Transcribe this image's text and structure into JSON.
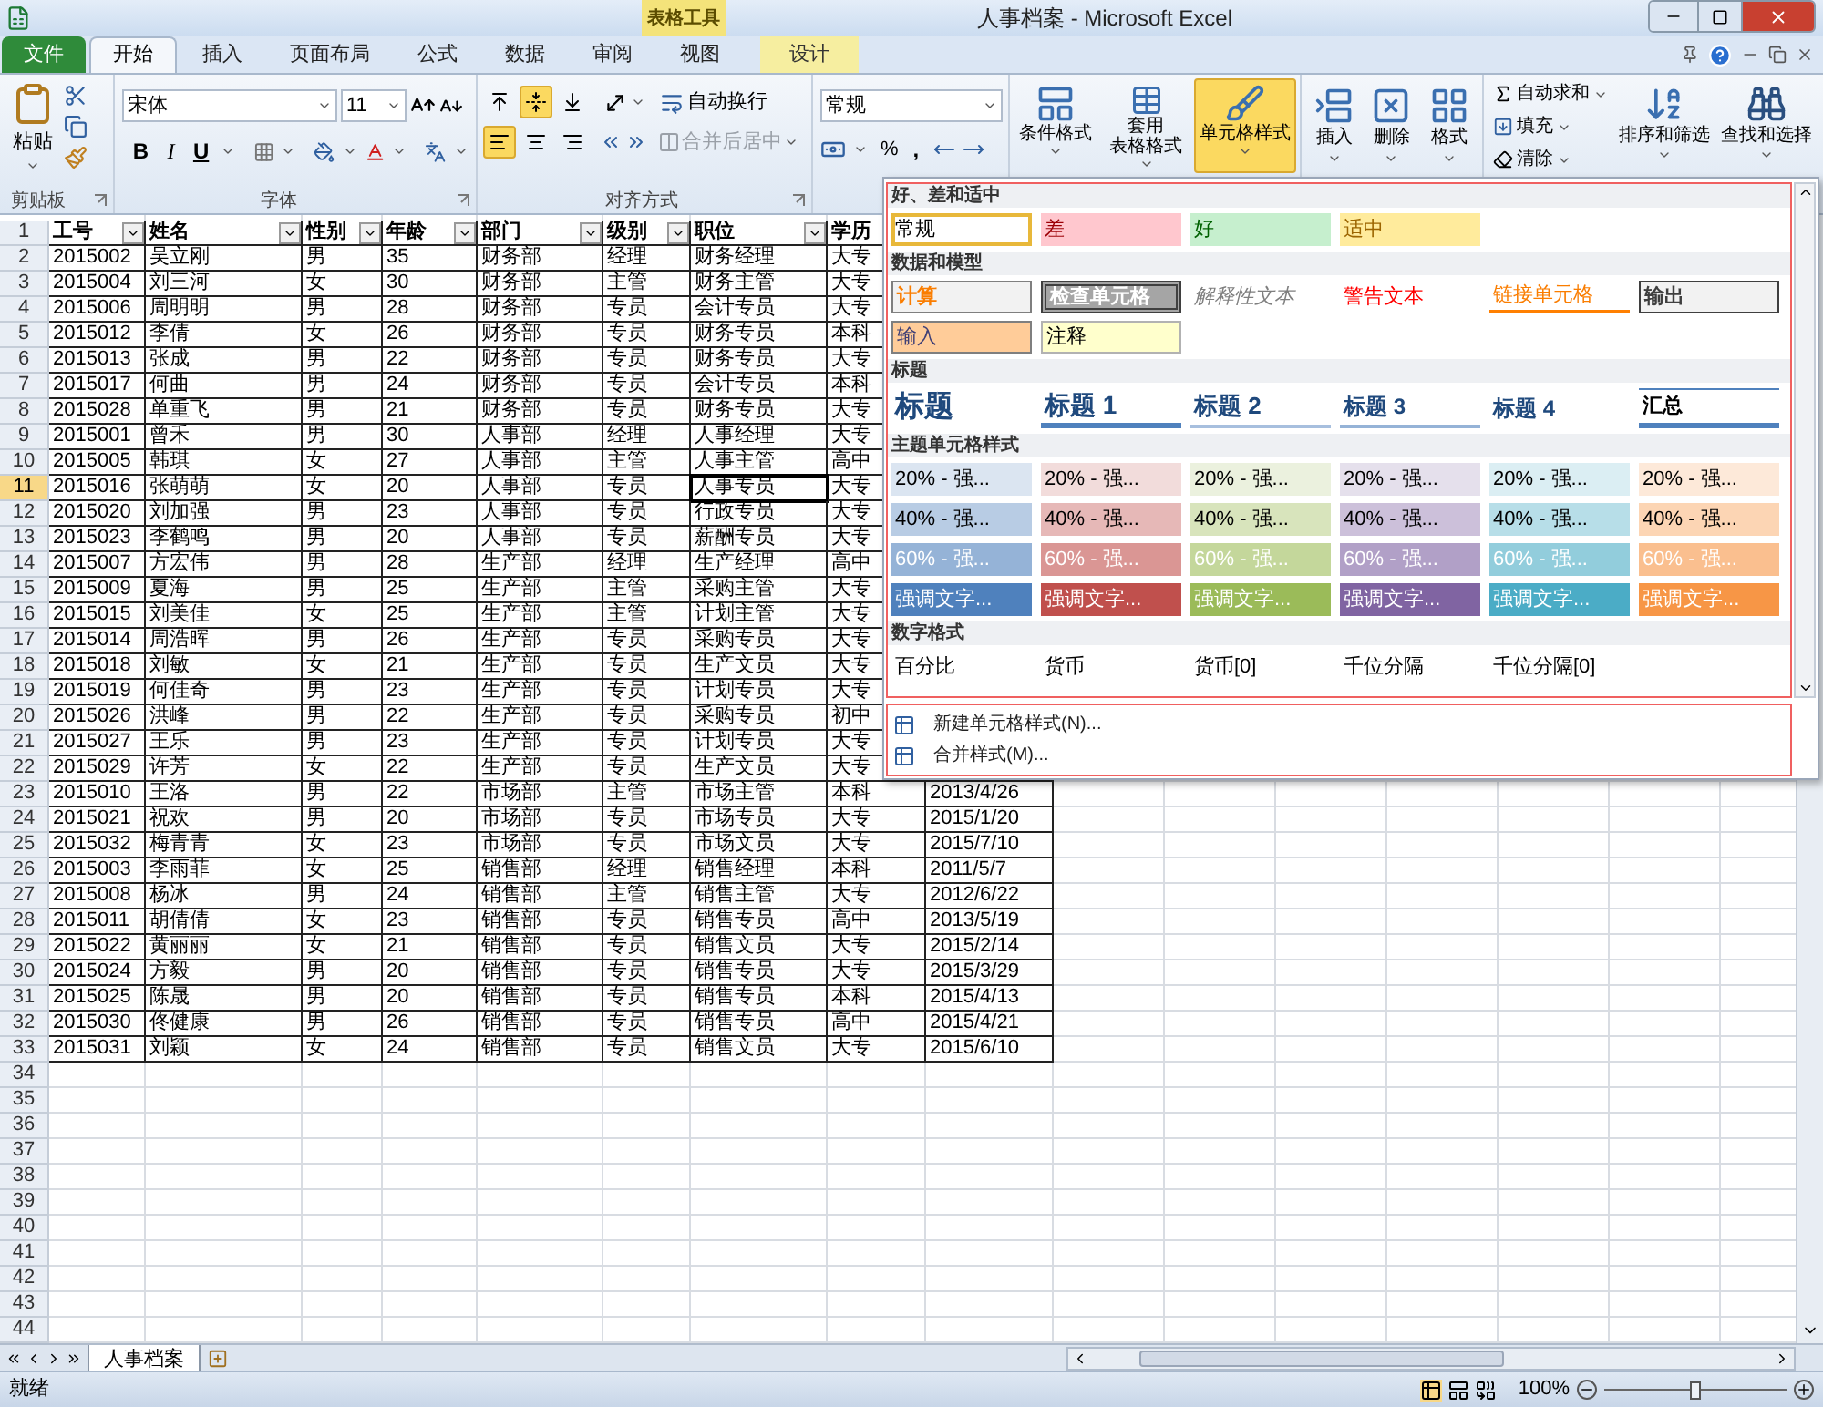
{
  "title_bar": {
    "context_group": "表格工具",
    "title": "人事档案 - Microsoft Excel"
  },
  "tabs": [
    {
      "label": "文件",
      "kind": "file",
      "selected": false
    },
    {
      "label": "开始",
      "kind": "normal",
      "selected": true
    },
    {
      "label": "插入",
      "kind": "normal",
      "selected": false
    },
    {
      "label": "页面布局",
      "kind": "normal",
      "selected": false
    },
    {
      "label": "公式",
      "kind": "normal",
      "selected": false
    },
    {
      "label": "数据",
      "kind": "normal",
      "selected": false
    },
    {
      "label": "审阅",
      "kind": "normal",
      "selected": false
    },
    {
      "label": "视图",
      "kind": "normal",
      "selected": false
    },
    {
      "label": "设计",
      "kind": "context",
      "selected": false
    }
  ],
  "ribbon": {
    "clipboard": {
      "paste": "粘贴",
      "label": "剪贴板"
    },
    "font": {
      "name": "宋体",
      "size": "11",
      "bold": "B",
      "italic": "I",
      "underline": "U",
      "label": "字体"
    },
    "alignment": {
      "vertical": [
        {
          "kind": "top",
          "selected": false
        },
        {
          "kind": "middle",
          "selected": true
        },
        {
          "kind": "bottom",
          "selected": false
        }
      ],
      "horizontal": [
        {
          "kind": "left",
          "selected": true
        },
        {
          "kind": "center",
          "selected": false
        },
        {
          "kind": "right",
          "selected": false
        }
      ],
      "wrap": "自动换行",
      "merge": {
        "label": "合并后居中",
        "disabled": true
      },
      "label": "对齐方式"
    },
    "number": {
      "format": "常规",
      "percent": "%",
      "comma": ","
    },
    "styles": [
      {
        "lines": [
          "条件格式"
        ],
        "kind": "conditional",
        "selected": false
      },
      {
        "lines": [
          "套用",
          "表格格式"
        ],
        "kind": "table",
        "selected": false
      },
      {
        "lines": [
          "单元格样式"
        ],
        "kind": "cell",
        "selected": true
      }
    ],
    "cells": [
      {
        "label": "插入",
        "kind": "insert"
      },
      {
        "label": "删除",
        "kind": "delete"
      },
      {
        "label": "格式",
        "kind": "format"
      }
    ],
    "editing": {
      "autosum": "自动求和",
      "fill": "填充",
      "clear": "清除",
      "sort": "排序和筛选",
      "find": "查找和选择"
    }
  },
  "sheet": {
    "columns": [
      {
        "label": "工号",
        "filter": true
      },
      {
        "label": "姓名",
        "filter": true
      },
      {
        "label": "性别",
        "filter": true
      },
      {
        "label": "年龄",
        "filter": true
      },
      {
        "label": "部门",
        "filter": true
      },
      {
        "label": "级别",
        "filter": true
      },
      {
        "label": "职位",
        "filter": true
      },
      {
        "label": "学历"
      }
    ],
    "header_row": "1",
    "rows": [
      {
        "number": "2",
        "selected": false,
        "cells": [
          "2015002",
          "吴立刚",
          "男",
          "35",
          "财务部",
          "经理",
          "财务经理",
          "大专"
        ]
      },
      {
        "number": "3",
        "selected": false,
        "cells": [
          "2015004",
          "刘三河",
          "女",
          "30",
          "财务部",
          "主管",
          "财务主管",
          "大专"
        ]
      },
      {
        "number": "4",
        "selected": false,
        "cells": [
          "2015006",
          "周明明",
          "男",
          "28",
          "财务部",
          "专员",
          "会计专员",
          "大专"
        ]
      },
      {
        "number": "5",
        "selected": false,
        "cells": [
          "2015012",
          "李倩",
          "女",
          "26",
          "财务部",
          "专员",
          "财务专员",
          "本科"
        ]
      },
      {
        "number": "6",
        "selected": false,
        "cells": [
          "2015013",
          "张成",
          "男",
          "22",
          "财务部",
          "专员",
          "财务专员",
          "大专"
        ]
      },
      {
        "number": "7",
        "selected": false,
        "cells": [
          "2015017",
          "何曲",
          "男",
          "24",
          "财务部",
          "专员",
          "会计专员",
          "本科"
        ]
      },
      {
        "number": "8",
        "selected": false,
        "cells": [
          "2015028",
          "单重飞",
          "男",
          "21",
          "财务部",
          "专员",
          "财务专员",
          "大专"
        ]
      },
      {
        "number": "9",
        "selected": false,
        "cells": [
          "2015001",
          "曾禾",
          "男",
          "30",
          "人事部",
          "经理",
          "人事经理",
          "大专"
        ]
      },
      {
        "number": "10",
        "selected": false,
        "cells": [
          "2015005",
          "韩琪",
          "女",
          "27",
          "人事部",
          "主管",
          "人事主管",
          "高中"
        ]
      },
      {
        "number": "11",
        "selected": true,
        "cells": [
          {
            "text": "2015016",
            "selected": false
          },
          {
            "text": "张萌萌",
            "selected": false
          },
          {
            "text": "女",
            "selected": false
          },
          {
            "text": "20",
            "selected": false
          },
          {
            "text": "人事部",
            "selected": false
          },
          {
            "text": "专员",
            "selected": false
          },
          {
            "text": "人事专员",
            "selected": true
          },
          {
            "text": "大专",
            "selected": false
          }
        ]
      },
      {
        "number": "12",
        "selected": false,
        "cells": [
          "2015020",
          "刘加强",
          "男",
          "23",
          "人事部",
          "专员",
          "行政专员",
          "大专"
        ]
      },
      {
        "number": "13",
        "selected": false,
        "cells": [
          "2015023",
          "李鹤鸣",
          "男",
          "20",
          "人事部",
          "专员",
          "薪酬专员",
          "大专"
        ]
      },
      {
        "number": "14",
        "selected": false,
        "cells": [
          "2015007",
          "方宏伟",
          "男",
          "28",
          "生产部",
          "经理",
          "生产经理",
          "高中"
        ]
      },
      {
        "number": "15",
        "selected": false,
        "cells": [
          "2015009",
          "夏海",
          "男",
          "25",
          "生产部",
          "主管",
          "采购主管",
          "大专"
        ]
      },
      {
        "number": "16",
        "selected": false,
        "cells": [
          "2015015",
          "刘美佳",
          "女",
          "25",
          "生产部",
          "主管",
          "计划主管",
          "大专"
        ]
      },
      {
        "number": "17",
        "selected": false,
        "cells": [
          "2015014",
          "周浩晖",
          "男",
          "26",
          "生产部",
          "专员",
          "采购专员",
          "大专"
        ]
      },
      {
        "number": "18",
        "selected": false,
        "cells": [
          "2015018",
          "刘敏",
          "女",
          "21",
          "生产部",
          "专员",
          "生产文员",
          "大专"
        ]
      },
      {
        "number": "19",
        "selected": false,
        "cells": [
          "2015019",
          "何佳奇",
          "男",
          "23",
          "生产部",
          "专员",
          "计划专员",
          "大专"
        ]
      },
      {
        "number": "20",
        "selected": false,
        "cells": [
          "2015026",
          "洪峰",
          "男",
          "22",
          "生产部",
          "专员",
          "采购专员",
          "初中"
        ]
      },
      {
        "number": "21",
        "selected": false,
        "cells": [
          "2015027",
          "王乐",
          "男",
          "23",
          "生产部",
          "专员",
          "计划专员",
          "大专"
        ]
      },
      {
        "number": "22",
        "selected": false,
        "cells": [
          "2015029",
          "许芳",
          "女",
          "22",
          "生产部",
          "专员",
          "生产文员",
          "大专"
        ]
      },
      {
        "number": "23",
        "selected": false,
        "cells": [
          "2015010",
          "王洛",
          "男",
          "22",
          "市场部",
          "主管",
          "市场主管",
          "本科",
          "2013/4/26"
        ]
      },
      {
        "number": "24",
        "selected": false,
        "cells": [
          "2015021",
          "祝欢",
          "男",
          "20",
          "市场部",
          "专员",
          "市场专员",
          "大专",
          "2015/1/20"
        ]
      },
      {
        "number": "25",
        "selected": false,
        "cells": [
          "2015032",
          "梅青青",
          "女",
          "23",
          "市场部",
          "专员",
          "市场文员",
          "大专",
          "2015/7/10"
        ]
      },
      {
        "number": "26",
        "selected": false,
        "cells": [
          "2015003",
          "李雨菲",
          "女",
          "25",
          "销售部",
          "经理",
          "销售经理",
          "本科",
          "2011/5/7"
        ]
      },
      {
        "number": "27",
        "selected": false,
        "cells": [
          "2015008",
          "杨冰",
          "男",
          "24",
          "销售部",
          "主管",
          "销售主管",
          "大专",
          "2012/6/22"
        ]
      },
      {
        "number": "28",
        "selected": false,
        "cells": [
          "2015011",
          "胡倩倩",
          "女",
          "23",
          "销售部",
          "专员",
          "销售专员",
          "高中",
          "2013/5/19"
        ]
      },
      {
        "number": "29",
        "selected": false,
        "cells": [
          "2015022",
          "黄丽丽",
          "女",
          "21",
          "销售部",
          "专员",
          "销售文员",
          "大专",
          "2015/2/14"
        ]
      },
      {
        "number": "30",
        "selected": false,
        "cells": [
          "2015024",
          "方毅",
          "男",
          "20",
          "销售部",
          "专员",
          "销售专员",
          "大专",
          "2015/3/29"
        ]
      },
      {
        "number": "31",
        "selected": false,
        "cells": [
          "2015025",
          "陈晟",
          "男",
          "20",
          "销售部",
          "专员",
          "销售专员",
          "本科",
          "2015/4/13"
        ]
      },
      {
        "number": "32",
        "selected": false,
        "cells": [
          "2015030",
          "佟健康",
          "男",
          "26",
          "销售部",
          "专员",
          "销售专员",
          "高中",
          "2015/4/21"
        ]
      },
      {
        "number": "33",
        "selected": false,
        "cells": [
          "2015031",
          "刘颖",
          "女",
          "24",
          "销售部",
          "专员",
          "销售文员",
          "大专",
          "2015/6/10"
        ]
      }
    ],
    "empty_rows": [
      "34",
      "35",
      "36",
      "37",
      "38",
      "39",
      "40",
      "41",
      "42",
      "43",
      "44"
    ]
  },
  "gallery": {
    "sections": [
      {
        "title": "好、差和适中",
        "styles": [
          {
            "label": "常规",
            "kind": "normal",
            "selected": true
          },
          {
            "label": "差",
            "kind": "bad",
            "selected": false
          },
          {
            "label": "好",
            "kind": "good",
            "selected": false
          },
          {
            "label": "适中",
            "kind": "neutral",
            "selected": false
          }
        ]
      },
      {
        "title": "数据和模型",
        "styles": [
          {
            "label": "计算",
            "kind": "calc",
            "selected": false
          },
          {
            "label": "检查单元格",
            "kind": "check",
            "selected": false
          },
          {
            "label": "解释性文本",
            "kind": "explanatory",
            "selected": false
          },
          {
            "label": "警告文本",
            "kind": "warning",
            "selected": false
          },
          {
            "label": "链接单元格",
            "kind": "linked",
            "selected": false
          },
          {
            "label": "输出",
            "kind": "output",
            "selected": false
          },
          {
            "label": "输入",
            "kind": "input",
            "selected": false
          },
          {
            "label": "注释",
            "kind": "note",
            "selected": false
          }
        ]
      },
      {
        "title": "标题",
        "styles": [
          {
            "label": "标题",
            "kind": "title",
            "selected": false
          },
          {
            "label": "标题 1",
            "kind": "h1",
            "selected": false
          },
          {
            "label": "标题 2",
            "kind": "h2",
            "selected": false
          },
          {
            "label": "标题 3",
            "kind": "h3",
            "selected": false
          },
          {
            "label": "标题 4",
            "kind": "h4",
            "selected": false
          },
          {
            "label": "汇总",
            "kind": "total",
            "selected": false
          }
        ]
      },
      {
        "title": "主题单元格样式",
        "styles": [
          {
            "label": "20% - 强...",
            "kind": "light",
            "color": "#dbe5f1",
            "selected": false
          },
          {
            "label": "20% - 强...",
            "kind": "light",
            "color": "#f2dcdb",
            "selected": false
          },
          {
            "label": "20% - 强...",
            "kind": "light",
            "color": "#ebf1de",
            "selected": false
          },
          {
            "label": "20% - 强...",
            "kind": "light",
            "color": "#e5e0ec",
            "selected": false
          },
          {
            "label": "20% - 强...",
            "kind": "light",
            "color": "#dbeef3",
            "selected": false
          },
          {
            "label": "20% - 强...",
            "kind": "light",
            "color": "#fde9d9",
            "selected": false
          },
          {
            "label": "40% - 强...",
            "kind": "light",
            "color": "#b8cce4",
            "selected": false
          },
          {
            "label": "40% - 强...",
            "kind": "light",
            "color": "#e6b8b7",
            "selected": false
          },
          {
            "label": "40% - 强...",
            "kind": "light",
            "color": "#d8e4bc",
            "selected": false
          },
          {
            "label": "40% - 强...",
            "kind": "light",
            "color": "#ccc0da",
            "selected": false
          },
          {
            "label": "40% - 强...",
            "kind": "light",
            "color": "#b7dee8",
            "selected": false
          },
          {
            "label": "40% - 强...",
            "kind": "light",
            "color": "#fcd5b4",
            "selected": false
          },
          {
            "label": "60% - 强...",
            "kind": "dark",
            "color": "#95b3d7",
            "selected": false
          },
          {
            "label": "60% - 强...",
            "kind": "dark",
            "color": "#da9694",
            "selected": false
          },
          {
            "label": "60% - 强...",
            "kind": "dark",
            "color": "#c4d79b",
            "selected": false
          },
          {
            "label": "60% - 强...",
            "kind": "dark",
            "color": "#b1a0c7",
            "selected": false
          },
          {
            "label": "60% - 强...",
            "kind": "dark",
            "color": "#92cddc",
            "selected": false
          },
          {
            "label": "60% - 强...",
            "kind": "dark",
            "color": "#fabf8f",
            "selected": false
          },
          {
            "label": "强调文字...",
            "kind": "dark",
            "color": "#4f81bd",
            "selected": false
          },
          {
            "label": "强调文字...",
            "kind": "dark",
            "color": "#c0504d",
            "selected": false
          },
          {
            "label": "强调文字...",
            "kind": "dark",
            "color": "#9bbb59",
            "selected": false
          },
          {
            "label": "强调文字...",
            "kind": "dark",
            "color": "#8064a2",
            "selected": false
          },
          {
            "label": "强调文字...",
            "kind": "dark",
            "color": "#4bacc6",
            "selected": false
          },
          {
            "label": "强调文字...",
            "kind": "dark",
            "color": "#f79646",
            "selected": false
          }
        ]
      },
      {
        "title": "数字格式",
        "styles": [
          {
            "label": "百分比",
            "kind": "number",
            "selected": false
          },
          {
            "label": "货币",
            "kind": "number",
            "selected": false
          },
          {
            "label": "货币[0]",
            "kind": "number",
            "selected": false
          },
          {
            "label": "千位分隔",
            "kind": "number",
            "selected": false
          },
          {
            "label": "千位分隔[0]",
            "kind": "number",
            "selected": false
          }
        ]
      }
    ],
    "menu": [
      "新建单元格样式(N)...",
      "合并样式(M)..."
    ]
  },
  "sheet_tabs": [
    {
      "label": "人事档案",
      "selected": true
    }
  ],
  "status_bar": {
    "status": "就绪",
    "zoom": "100%",
    "level": 0.5
  }
}
